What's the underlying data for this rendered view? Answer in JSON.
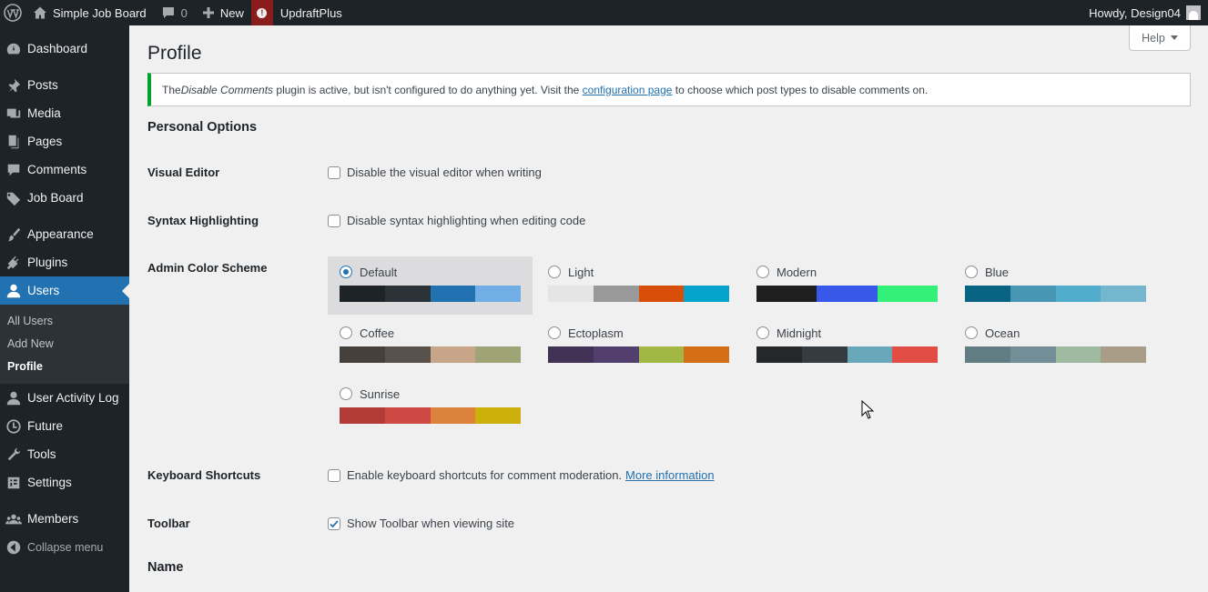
{
  "adminbar": {
    "site_name": "Simple Job Board",
    "comments_count": "0",
    "new_label": "New",
    "plugin_label": "UpdraftPlus",
    "howdy": "Howdy, Design04"
  },
  "sidebar": {
    "items": [
      {
        "label": "Dashboard",
        "icon": "dashboard-icon"
      },
      {
        "label": "Posts",
        "icon": "pin-icon"
      },
      {
        "label": "Media",
        "icon": "media-icon"
      },
      {
        "label": "Pages",
        "icon": "pages-icon"
      },
      {
        "label": "Comments",
        "icon": "comment-icon"
      },
      {
        "label": "Job Board",
        "icon": "tag-icon"
      },
      {
        "label": "Appearance",
        "icon": "brush-icon"
      },
      {
        "label": "Plugins",
        "icon": "plug-icon"
      },
      {
        "label": "Users",
        "icon": "user-icon"
      },
      {
        "label": "User Activity Log",
        "icon": "user-icon"
      },
      {
        "label": "Future",
        "icon": "clock-icon"
      },
      {
        "label": "Tools",
        "icon": "wrench-icon"
      },
      {
        "label": "Settings",
        "icon": "settings-icon"
      },
      {
        "label": "Members",
        "icon": "members-icon"
      },
      {
        "label": "Collapse menu",
        "icon": "collapse-icon"
      }
    ],
    "submenu": [
      "All Users",
      "Add New",
      "Profile"
    ]
  },
  "help_label": "Help",
  "page_title": "Profile",
  "notice": {
    "prefix": "The ",
    "plugin_name": "Disable Comments",
    "middle": " plugin is active, but isn't configured to do anything yet. Visit the ",
    "link": "configuration page",
    "suffix": " to choose which post types to disable comments on."
  },
  "personal_options": {
    "title": "Personal Options",
    "visual_editor": {
      "label": "Visual Editor",
      "text": "Disable the visual editor when writing",
      "checked": false
    },
    "syntax": {
      "label": "Syntax Highlighting",
      "text": "Disable syntax highlighting when editing code",
      "checked": false
    },
    "color_scheme_label": "Admin Color Scheme",
    "schemes": [
      {
        "name": "Default",
        "selected": true,
        "colors": [
          "#1d2327",
          "#2c3338",
          "#2271b1",
          "#72aee6"
        ]
      },
      {
        "name": "Light",
        "selected": false,
        "colors": [
          "#e5e5e5",
          "#999999",
          "#d64e07",
          "#04a4cc"
        ]
      },
      {
        "name": "Modern",
        "selected": false,
        "colors": [
          "#1e1e1e",
          "#3858e9",
          "#33f078"
        ]
      },
      {
        "name": "Blue",
        "selected": false,
        "colors": [
          "#096484",
          "#4796b3",
          "#52accc",
          "#74b6ce"
        ]
      },
      {
        "name": "Coffee",
        "selected": false,
        "colors": [
          "#46403c",
          "#59524c",
          "#c7a589",
          "#9ea476"
        ]
      },
      {
        "name": "Ectoplasm",
        "selected": false,
        "colors": [
          "#413256",
          "#523f6d",
          "#a3b745",
          "#d46f15"
        ]
      },
      {
        "name": "Midnight",
        "selected": false,
        "colors": [
          "#25282b",
          "#363b3f",
          "#69a8bb",
          "#e14d43"
        ]
      },
      {
        "name": "Ocean",
        "selected": false,
        "colors": [
          "#627c83",
          "#738e96",
          "#9ebaa0",
          "#aa9d88"
        ]
      },
      {
        "name": "Sunrise",
        "selected": false,
        "colors": [
          "#b43c38",
          "#cf4944",
          "#dd823b",
          "#ccaf0b"
        ]
      }
    ],
    "keyboard": {
      "label": "Keyboard Shortcuts",
      "text": "Enable keyboard shortcuts for comment moderation.",
      "link": "More information",
      "checked": false
    },
    "toolbar": {
      "label": "Toolbar",
      "text": "Show Toolbar when viewing site",
      "checked": true
    }
  },
  "name_section_title": "Name"
}
